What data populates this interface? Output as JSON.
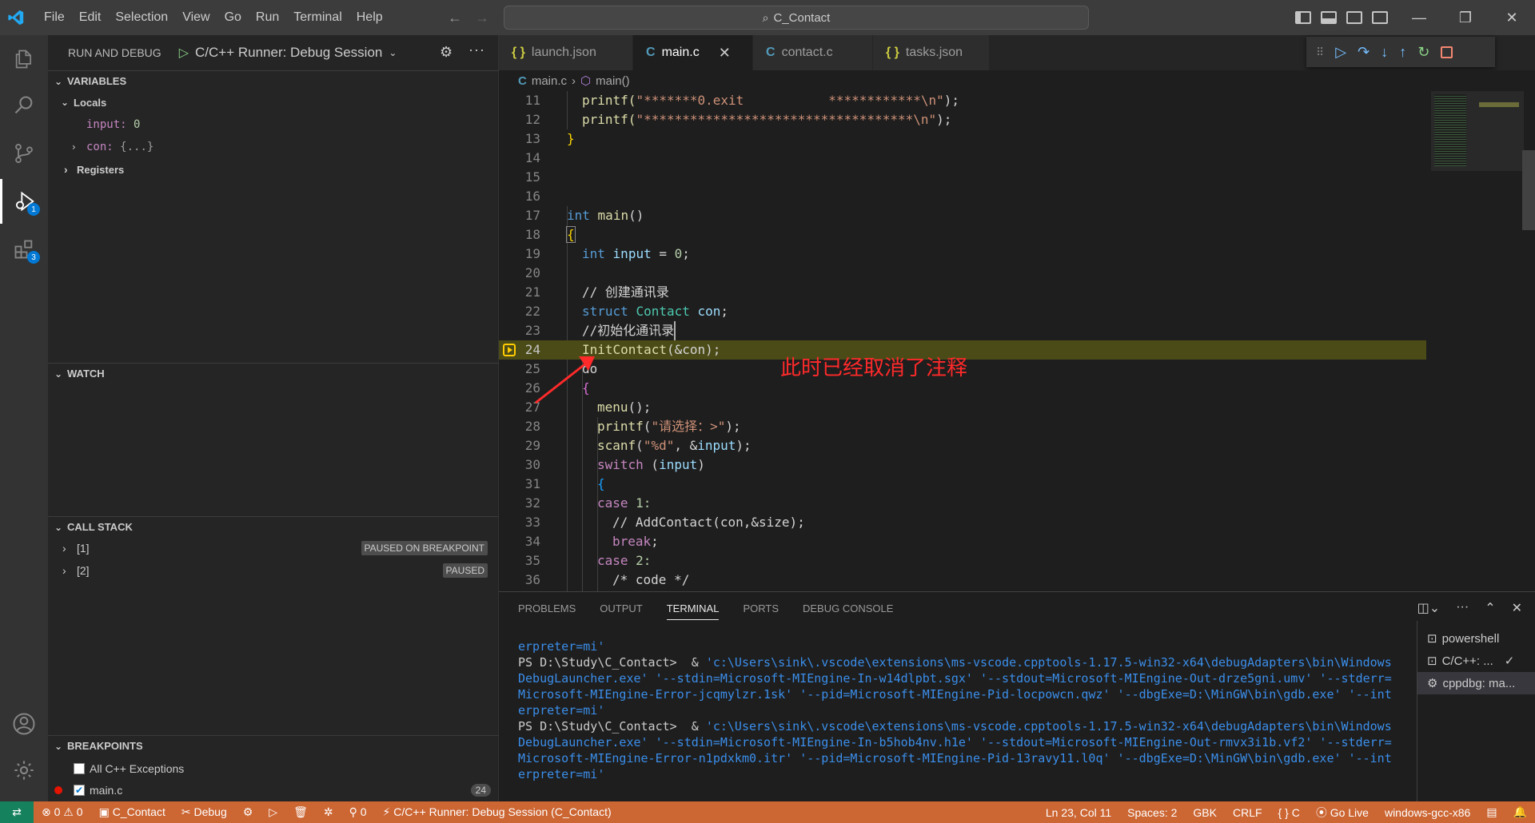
{
  "titlebar": {
    "menu": [
      "File",
      "Edit",
      "Selection",
      "View",
      "Go",
      "Run",
      "Terminal",
      "Help"
    ],
    "search": "C_Contact"
  },
  "activity": {
    "debug_badge": "1",
    "extensions_badge": "3"
  },
  "sidebar": {
    "title": "RUN AND DEBUG",
    "config": "C/C++ Runner: Debug Session",
    "variables": {
      "title": "VARIABLES",
      "locals_label": "Locals",
      "input_name": "input:",
      "input_value": "0",
      "con_name": "con:",
      "con_value": "{...}",
      "registers_label": "Registers"
    },
    "watch_title": "WATCH",
    "callstack": {
      "title": "CALL STACK",
      "items": [
        {
          "label": "[1]",
          "status": "PAUSED ON BREAKPOINT"
        },
        {
          "label": "[2]",
          "status": "PAUSED"
        }
      ]
    },
    "breakpoints": {
      "title": "BREAKPOINTS",
      "items": [
        {
          "label": "All C++ Exceptions",
          "count": ""
        },
        {
          "label": "main.c",
          "count": "24"
        }
      ]
    }
  },
  "tabs": [
    {
      "icon": "{ }",
      "label": "launch.json"
    },
    {
      "icon": "C",
      "label": "main.c"
    },
    {
      "icon": "C",
      "label": "contact.c"
    },
    {
      "icon": "{ }",
      "label": "tasks.json"
    }
  ],
  "breadcrumb": {
    "file": "main.c",
    "symbol": "main()"
  },
  "editor": {
    "line_numbers": [
      "11",
      "12",
      "13",
      "14",
      "15",
      "16",
      "17",
      "18",
      "19",
      "20",
      "21",
      "22",
      "23",
      "24",
      "25",
      "26",
      "27",
      "28",
      "29",
      "30",
      "31",
      "32",
      "33",
      "34",
      "35",
      "36"
    ],
    "annotation": "此时已经取消了注释",
    "code": {
      "l11a": "printf(",
      "l11b": "\"*******0.exit           ************\\n\"",
      "l11c": ");",
      "l12a": "printf(",
      "l12b": "\"***********************************\\n\"",
      "l12c": ");",
      "l13": "}",
      "l17a": "int",
      "l17b": "main",
      "l17c": "()",
      "l18": "{",
      "l19a": "int",
      "l19b": "input",
      "l19c": " = ",
      "l19d": "0",
      "l19e": ";",
      "l21": "// 创建通讯录",
      "l22a": "struct",
      "l22b": "Contact",
      "l22c": "con",
      "l22d": ";",
      "l23": "//初始化通讯录",
      "l24a": "InitContact",
      "l24b": "(&con);",
      "l25": "do",
      "l26": "{",
      "l27a": "menu",
      "l27b": "();",
      "l28a": "printf",
      "l28b": "(",
      "l28c": "\"请选择：>\"",
      "l28d": ");",
      "l29a": "scanf",
      "l29b": "(",
      "l29c": "\"%d\"",
      "l29d": ", &",
      "l29e": "input",
      "l29f": ");",
      "l30a": "switch",
      "l30b": " (",
      "l30c": "input",
      "l30d": ")",
      "l31": "{",
      "l32a": "case",
      "l32b": " 1:",
      "l33": "// AddContact(con,&size);",
      "l34a": "break",
      "l34b": ";",
      "l35a": "case",
      "l35b": " 2:",
      "l36": "/* code */"
    }
  },
  "panel": {
    "tabs": [
      "PROBLEMS",
      "OUTPUT",
      "TERMINAL",
      "PORTS",
      "DEBUG CONSOLE"
    ],
    "terminal_lines": [
      {
        "prompt": "erpreter=mi'",
        "path": ""
      },
      {
        "prompt": "PS D:\\Study\\C_Contact>  & ",
        "path": "'c:\\Users\\sink\\.vscode\\extensions\\ms-vscode.cpptools-1.17.5-win32-x64\\debugAdapters\\bin\\Windows"
      },
      {
        "prompt": "",
        "path": "DebugLauncher.exe' '--stdin=Microsoft-MIEngine-In-w14dlpbt.sgx' '--stdout=Microsoft-MIEngine-Out-drze5gni.umv' '--stderr="
      },
      {
        "prompt": "",
        "path": "Microsoft-MIEngine-Error-jcqmylzr.1sk' '--pid=Microsoft-MIEngine-Pid-locpowcn.qwz' '--dbgExe=D:\\MinGW\\bin\\gdb.exe' '--int"
      },
      {
        "prompt": "",
        "path": "erpreter=mi'"
      },
      {
        "prompt": "PS D:\\Study\\C_Contact>  & ",
        "path": "'c:\\Users\\sink\\.vscode\\extensions\\ms-vscode.cpptools-1.17.5-win32-x64\\debugAdapters\\bin\\Windows"
      },
      {
        "prompt": "",
        "path": "DebugLauncher.exe' '--stdin=Microsoft-MIEngine-In-b5hob4nv.h1e' '--stdout=Microsoft-MIEngine-Out-rmvx3i1b.vf2' '--stderr="
      },
      {
        "prompt": "",
        "path": "Microsoft-MIEngine-Error-n1pdxkm0.itr' '--pid=Microsoft-MIEngine-Pid-13ravy11.l0q' '--dbgExe=D:\\MinGW\\bin\\gdb.exe' '--int"
      },
      {
        "prompt": "",
        "path": "erpreter=mi'"
      }
    ],
    "terminals": [
      "powershell",
      "C/C++: ...",
      "cppdbg: ma..."
    ]
  },
  "statusbar": {
    "errors": "0",
    "warnings": "0",
    "project": "C_Contact",
    "debug": "Debug",
    "ports": "0",
    "session": "C/C++ Runner: Debug Session (C_Contact)",
    "position": "Ln 23, Col 11",
    "spaces": "Spaces: 2",
    "encoding": "GBK",
    "eol": "CRLF",
    "language": "C",
    "golive": "Go Live",
    "compiler": "windows-gcc-x86"
  }
}
